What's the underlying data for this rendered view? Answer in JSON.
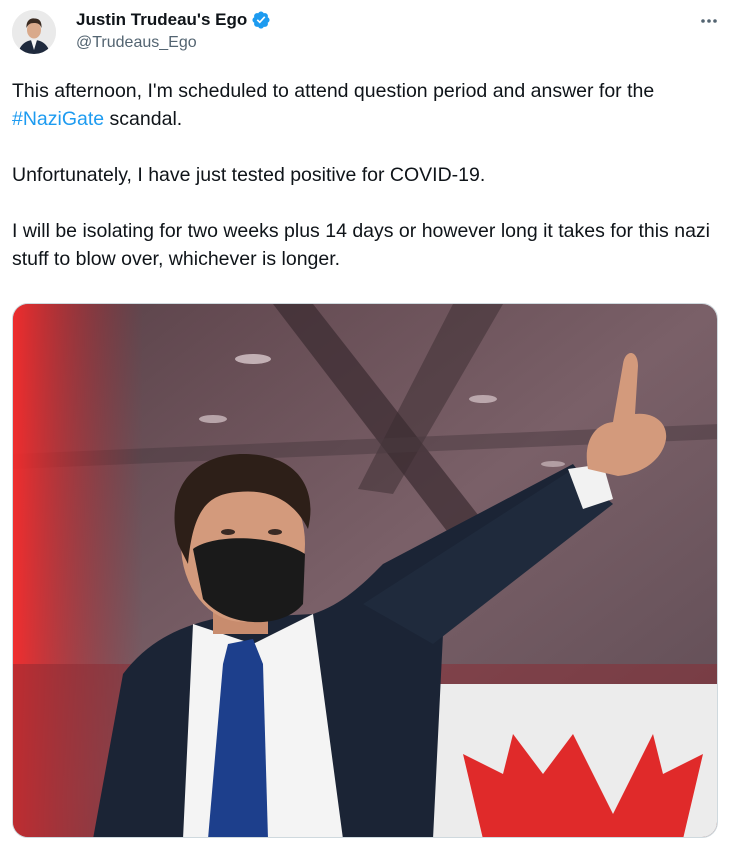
{
  "author": {
    "display_name": "Justin Trudeau's Ego",
    "handle": "@Trudeaus_Ego",
    "verified": true,
    "verified_color": "#1d9bf0"
  },
  "menu": {
    "icon": "more-horizontal-icon"
  },
  "tweet": {
    "line1_before": "This afternoon, I'm scheduled to attend question period and answer for the ",
    "hashtag": "#NaziGate",
    "line1_after": " scandal.",
    "paragraph2": "Unfortunately, I have just tested positive for COVID-19.",
    "paragraph3": "I will be isolating for two weeks plus 14 days or however long it takes for this nazi stuff to blow over, whichever is longer."
  },
  "colors": {
    "text": "#0f1419",
    "secondary": "#536471",
    "link": "#1d9bf0"
  }
}
